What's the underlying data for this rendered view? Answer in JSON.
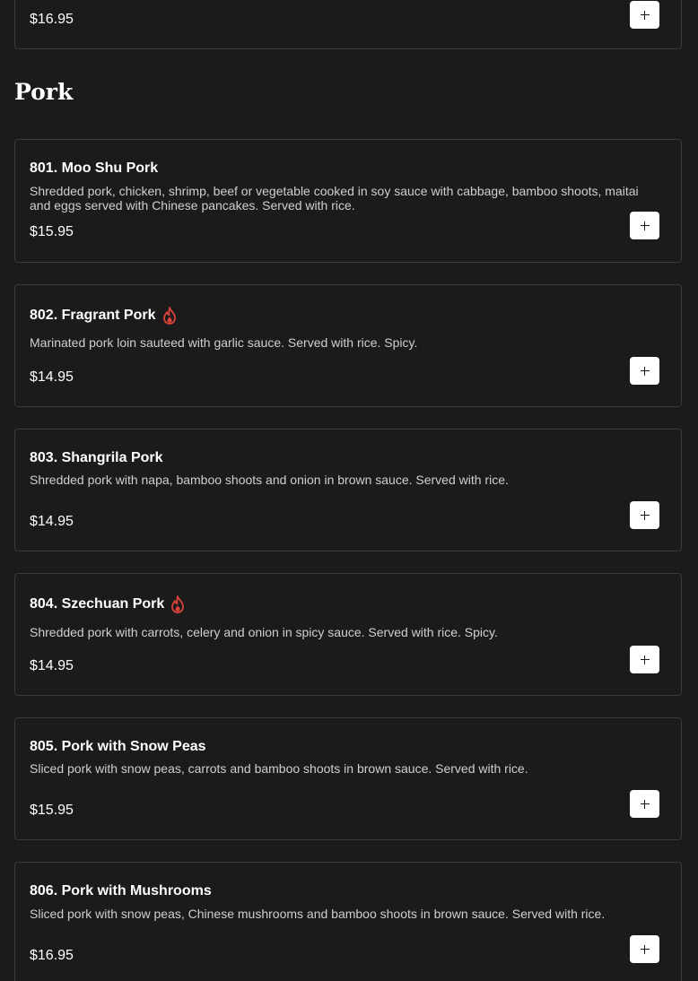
{
  "previous_item": {
    "price": "$16.95"
  },
  "section": {
    "title": "Pork"
  },
  "items": [
    {
      "name": "801. Moo Shu Pork",
      "description": "Shredded pork, chicken, shrimp, beef or vegetable cooked in soy sauce with cabbage, bamboo shoots, maitai and eggs served with Chinese pancakes. Served with rice.",
      "price": "$15.95",
      "spicy": false
    },
    {
      "name": "802. Fragrant Pork",
      "description": "Marinated pork loin sauteed with garlic sauce. Served with rice. Spicy.",
      "price": "$14.95",
      "spicy": true
    },
    {
      "name": "803. Shangrila Pork",
      "description": "Shredded pork with napa, bamboo shoots and onion in brown sauce. Served with rice.",
      "price": "$14.95",
      "spicy": false
    },
    {
      "name": "804. Szechuan Pork",
      "description": "Shredded pork with carrots, celery and onion in spicy sauce. Served with rice. Spicy.",
      "price": "$14.95",
      "spicy": true
    },
    {
      "name": "805. Pork with Snow Peas",
      "description": "Sliced pork with snow peas, carrots and bamboo shoots in brown sauce. Served with rice.",
      "price": "$15.95",
      "spicy": false
    },
    {
      "name": "806. Pork with Mushrooms",
      "description": "Sliced pork with snow peas, Chinese mushrooms and bamboo shoots in brown sauce. Served with rice.",
      "price": "$16.95",
      "spicy": false
    }
  ],
  "icons": {
    "add": "plus-icon",
    "spicy": "flame-icon"
  },
  "colors": {
    "background": "#1b1b1b",
    "spicy": "#d9433a",
    "button": "#ffffff"
  }
}
